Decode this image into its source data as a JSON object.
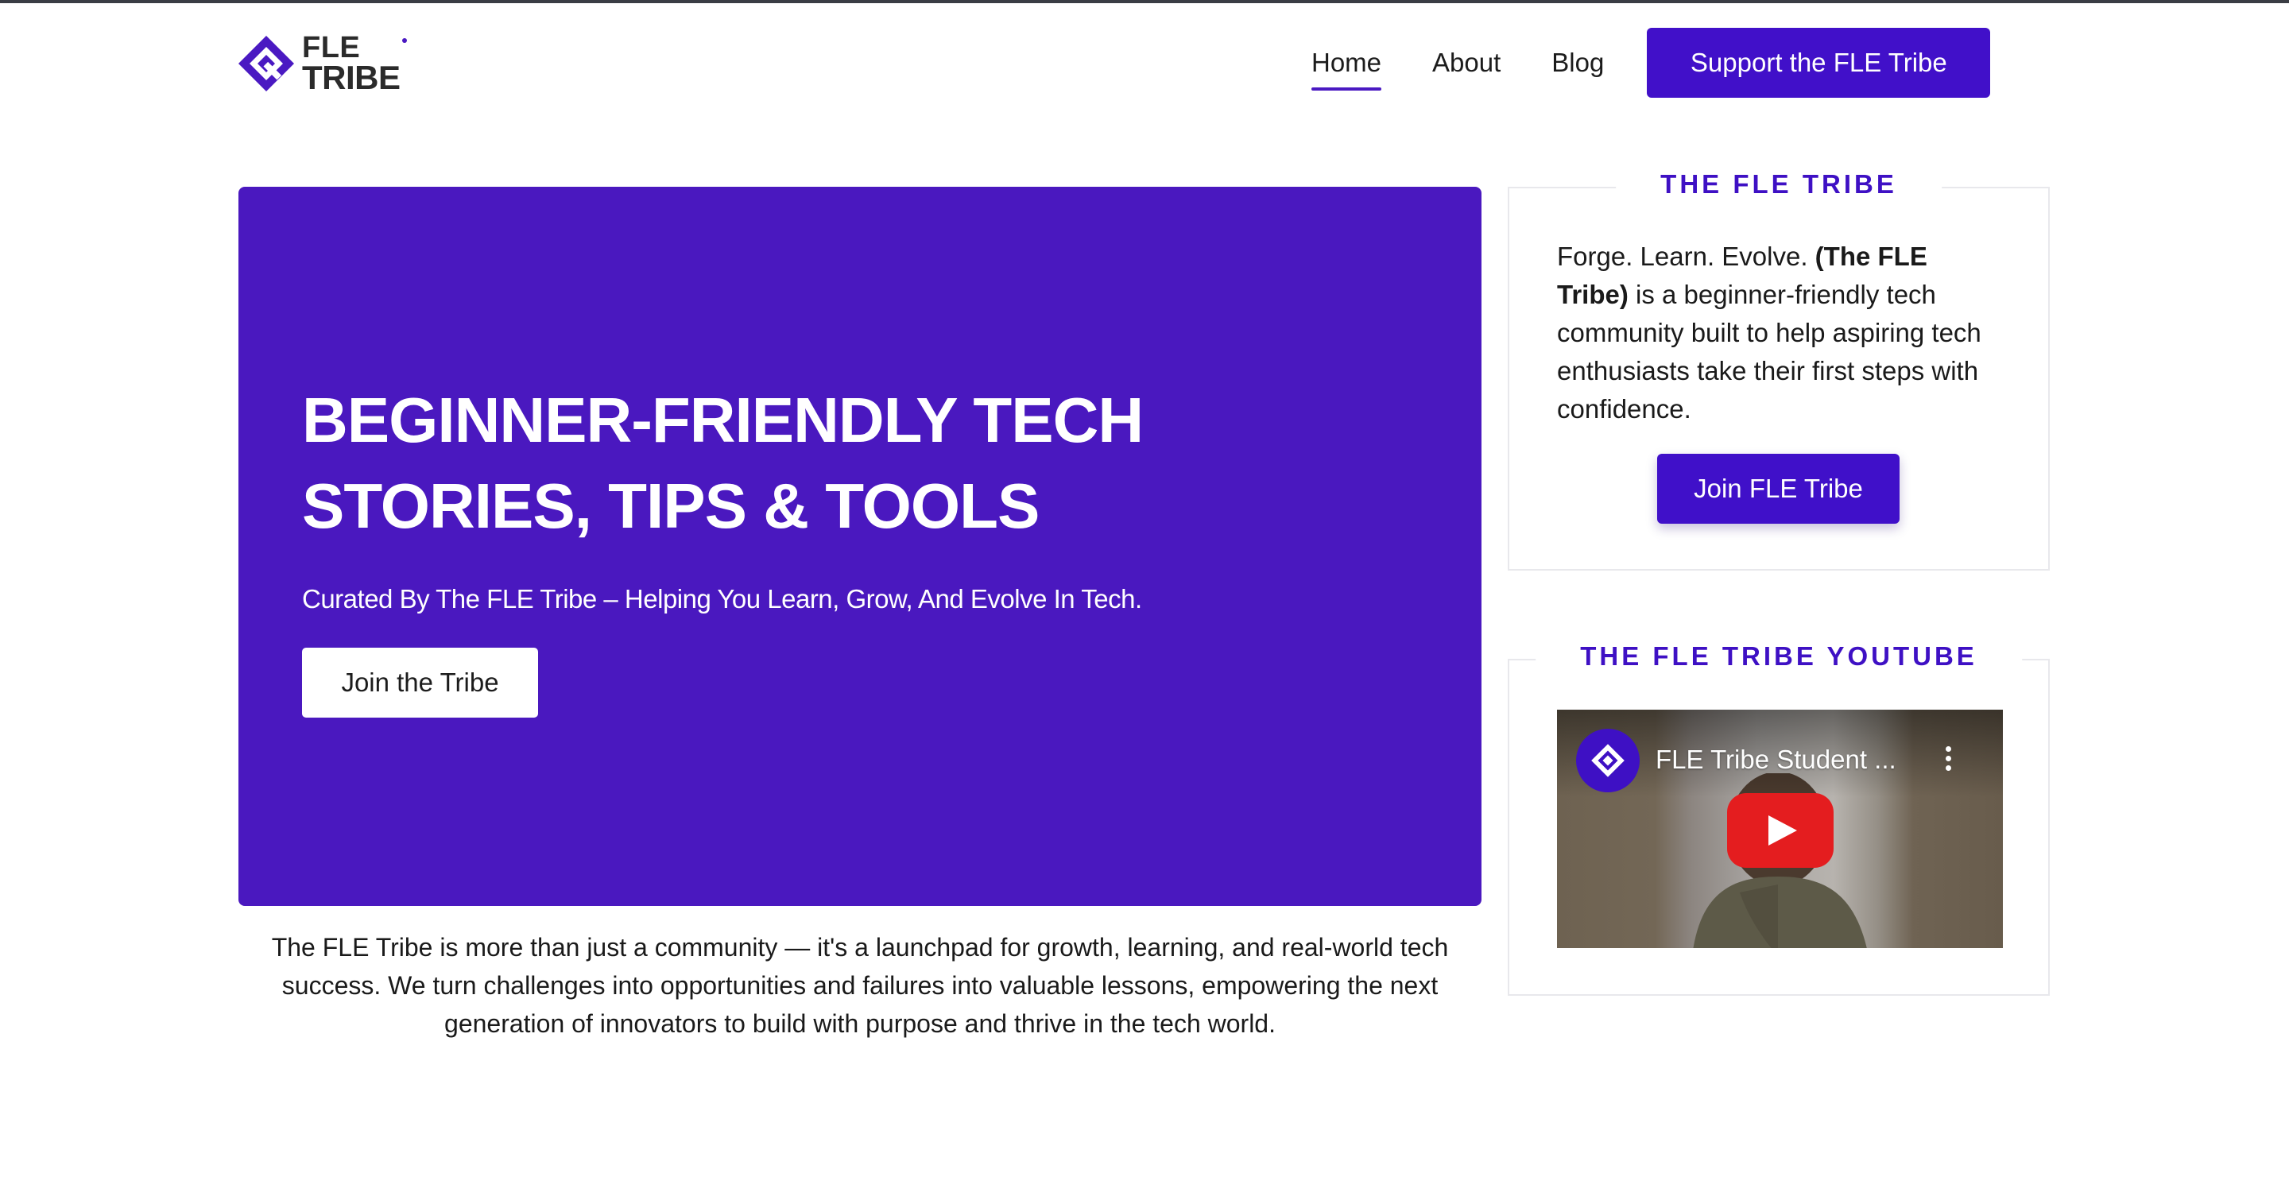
{
  "site": {
    "logo_line1": "FLE",
    "logo_line2": "TRIBE",
    "brand_color": "#4a18bf",
    "logo_icon": "fle-tribe-logo-icon"
  },
  "nav": {
    "items": [
      {
        "label": "Home",
        "active": true
      },
      {
        "label": "About",
        "active": false
      },
      {
        "label": "Blog",
        "active": false
      }
    ],
    "cta_label": "Support the FLE Tribe"
  },
  "hero": {
    "title": "BEGINNER-FRIENDLY TECH STORIES, TIPS & TOOLS",
    "subtitle": "Curated By The FLE Tribe – Helping You Learn, Grow, And Evolve In Tech.",
    "button_label": "Join the Tribe"
  },
  "about": {
    "text": "The FLE Tribe is more than just a community — it's a launchpad for growth, learning, and real-world tech success. We turn challenges into opportunities and failures into valuable lessons, empowering the next generation of innovators to build with purpose and thrive in the tech world."
  },
  "widgets": {
    "tribe": {
      "title": "THE FLE TRIBE",
      "text_intro": "Forge. Learn. Evolve. ",
      "text_bold": "(The FLE Tribe)",
      "text_rest": " is a beginner-friendly tech community built to help aspiring tech enthusiasts take their first steps with confidence.",
      "button_label": "Join FLE Tribe"
    },
    "youtube": {
      "title": "THE FLE TRIBE YOUTUBE",
      "video_title": "FLE Tribe Student ...",
      "play_icon": "youtube-play-icon",
      "menu_icon": "more-vertical-icon"
    }
  }
}
